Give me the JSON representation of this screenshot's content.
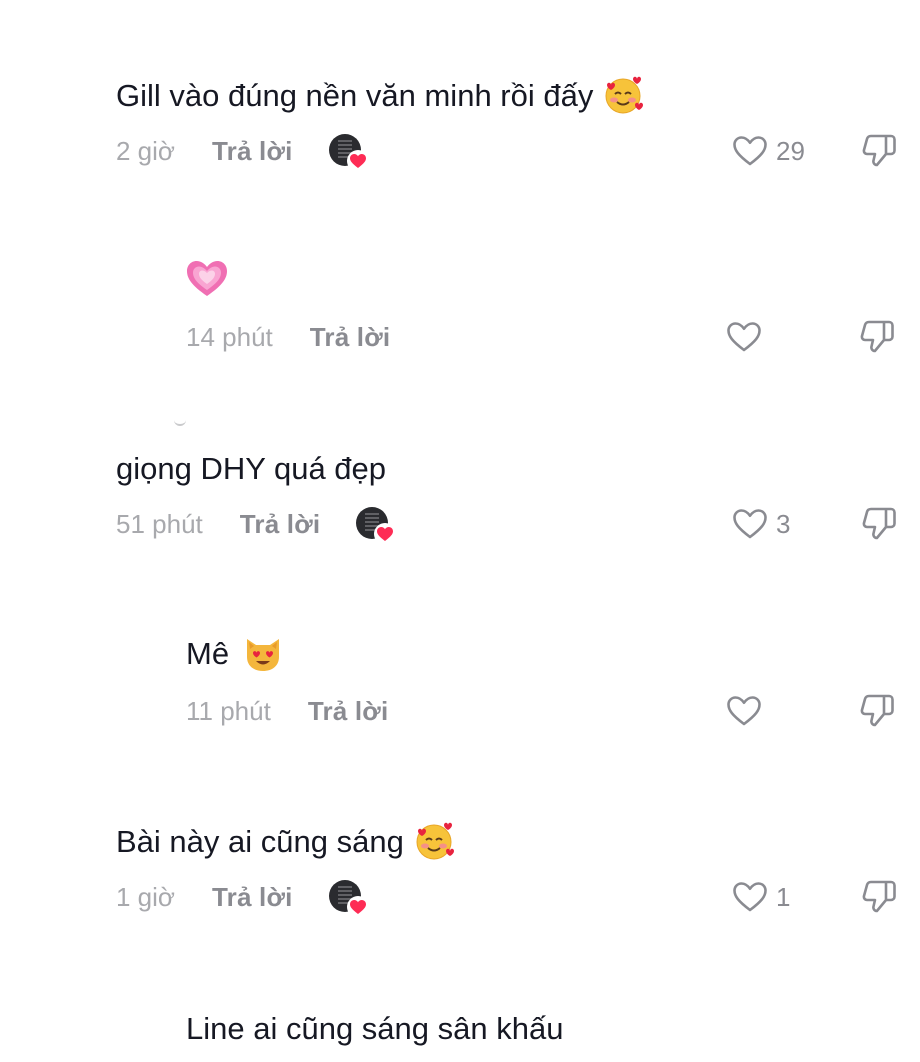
{
  "comments": [
    {
      "text": "Gill vào đúng nền văn minh rồi đấy",
      "emoji": "smiling-face-with-hearts",
      "time": "2 giờ",
      "reply_label": "Trả lời",
      "creator_liked": true,
      "like_count": "29"
    },
    {
      "text": "",
      "emoji": "growing-heart",
      "time": "14 phút",
      "reply_label": "Trả lời",
      "creator_liked": false,
      "like_count": ""
    },
    {
      "text": "giọng DHY quá đẹp",
      "emoji": "",
      "time": "51 phút",
      "reply_label": "Trả lời",
      "creator_liked": true,
      "like_count": "3"
    },
    {
      "text": "Mê",
      "emoji": "smiling-cat-with-heart-eyes",
      "time": "11 phút",
      "reply_label": "Trả lời",
      "creator_liked": false,
      "like_count": ""
    },
    {
      "text": "Bài này ai cũng sáng",
      "emoji": "smiling-face-with-hearts",
      "time": "1 giờ",
      "reply_label": "Trả lời",
      "creator_liked": true,
      "like_count": "1"
    },
    {
      "text": "Line ai cũng sáng sân khấu",
      "emoji": "",
      "time": "",
      "reply_label": "",
      "creator_liked": false,
      "like_count": ""
    }
  ],
  "icons": {
    "like": "heart-outline-icon",
    "dislike": "thumbs-down-icon",
    "creator_badge": "heart-badge-icon"
  },
  "colors": {
    "text": "#161823",
    "muted": "#a8a9ad",
    "reply": "#8a8b91",
    "accent": "#fe2c55"
  }
}
